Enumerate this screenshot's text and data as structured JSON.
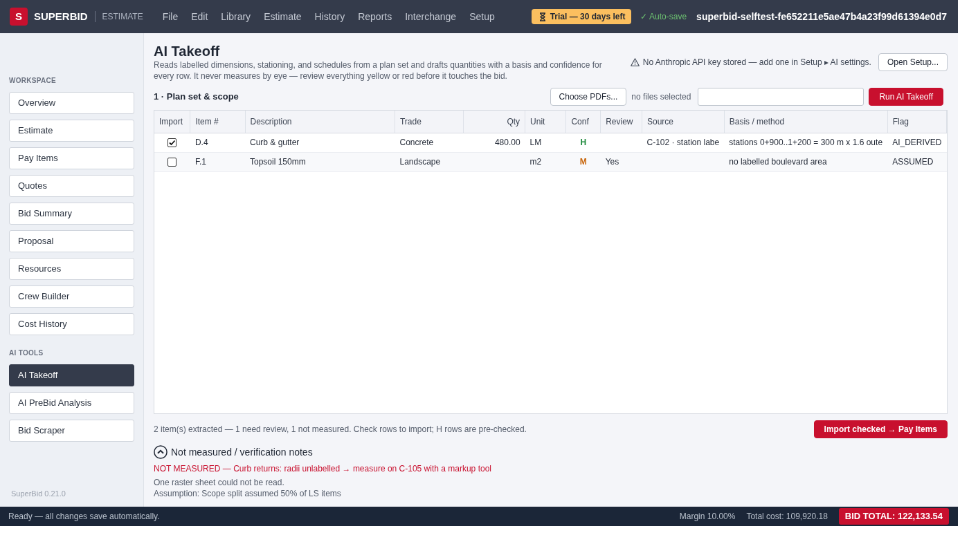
{
  "app": {
    "logo_letter": "S",
    "brand": "SUPERBID",
    "product": "ESTIMATE"
  },
  "menu": [
    "File",
    "Edit",
    "Library",
    "Estimate",
    "History",
    "Reports",
    "Interchange",
    "Setup"
  ],
  "topbar_right": {
    "trial": "Trial — 30 days left",
    "autosave": "✓ Auto-save",
    "project": "superbid-selftest-fe652211e5ae47b4a23f99d61394e0d7"
  },
  "sidebar": {
    "sections": [
      {
        "label": "WORKSPACE",
        "items": [
          {
            "label": "Overview",
            "selected": false
          },
          {
            "label": "Estimate",
            "selected": false
          },
          {
            "label": "Pay Items",
            "selected": false
          },
          {
            "label": "Quotes",
            "selected": false
          },
          {
            "label": "Bid Summary",
            "selected": false
          },
          {
            "label": "Proposal",
            "selected": false
          },
          {
            "label": "Resources",
            "selected": false
          },
          {
            "label": "Crew Builder",
            "selected": false
          },
          {
            "label": "Cost History",
            "selected": false
          }
        ]
      },
      {
        "label": "AI TOOLS",
        "items": [
          {
            "label": "AI Takeoff",
            "selected": true
          },
          {
            "label": "AI PreBid Analysis",
            "selected": false
          },
          {
            "label": "Bid Scraper",
            "selected": false
          }
        ]
      }
    ],
    "version": "SuperBid 0.21.0"
  },
  "page": {
    "title": "AI Takeoff",
    "description": "Reads labelled dimensions, stationing, and schedules from a plan set and drafts quantities with a basis and confidence for every row. It never measures by eye — review everything yellow or red before it touches the bid.",
    "api_warning": "No Anthropic API key stored — add one in Setup ▸ AI settings.",
    "setup_button": "Open Setup..."
  },
  "scope": {
    "heading": "1 · Plan set & scope",
    "choose_button": "Choose PDFs...",
    "file_status": "no files selected",
    "run_button": "Run AI Takeoff"
  },
  "table": {
    "columns": [
      "Import",
      "Item #",
      "Description",
      "Trade",
      "Qty",
      "Unit",
      "Conf",
      "Review",
      "Source",
      "Basis / method",
      "Flag"
    ],
    "rows": [
      {
        "checked": true,
        "item": "D.4",
        "description": "Curb & gutter",
        "trade": "Concrete",
        "qty": "480.00",
        "unit": "LM",
        "conf": {
          "label": "H",
          "color": "#1e8a3c"
        },
        "source": "C-102 · station labe",
        "basis": "stations 0+900..1+200 = 300 m x 1.6 oute",
        "flag": "AI_DERIVED"
      },
      {
        "checked": false,
        "item": "F.1",
        "description": "Topsoil 150mm",
        "trade": "Landscape",
        "unit": "m2",
        "conf": {
          "label": "M",
          "color": "#c8650a"
        },
        "review": "Yes",
        "basis": "no labelled boulevard area",
        "flag": "ASSUMED"
      }
    ]
  },
  "summary": "2 item(s) extracted — 1 need review, 1 not measured. Check rows to import; H rows are pre-checked.",
  "import_button": "Import checked → Pay Items",
  "notes": {
    "title": "Not measured / verification notes",
    "expanded": true,
    "items": [
      {
        "kind": "alert",
        "text": "NOT MEASURED — Curb returns: radii unlabelled → measure on C-105 with a markup tool"
      },
      {
        "kind": "info",
        "text": "One raster sheet could not be read."
      },
      {
        "kind": "info",
        "text": "Assumption: Scope split assumed 50% of LS items"
      }
    ]
  },
  "status_bar": {
    "message": "Ready — all changes save automatically.",
    "margin": "Margin 10.00%",
    "total_cost": "Total cost: 109,920.18",
    "bid_total": "BID TOTAL: 122,133.54"
  }
}
